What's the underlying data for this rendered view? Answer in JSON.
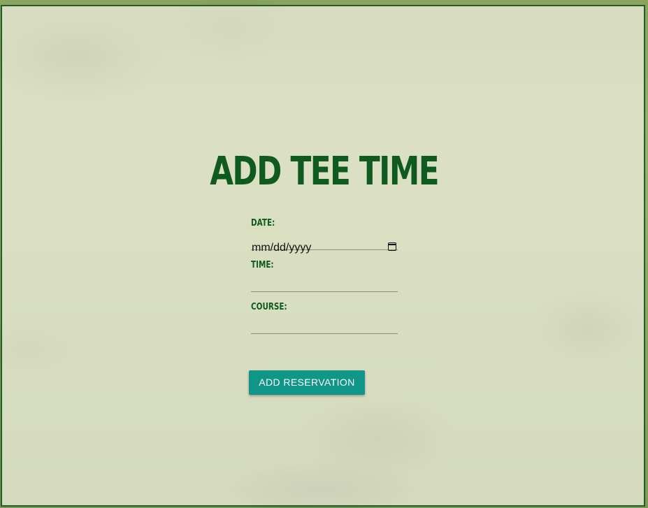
{
  "page": {
    "title": "ADD TEE TIME"
  },
  "form": {
    "date": {
      "label": "DATE:",
      "placeholder": "mm/dd/yyyy",
      "value": ""
    },
    "time": {
      "label": "TIME:",
      "value": ""
    },
    "course": {
      "label": "COURSE:",
      "value": ""
    },
    "submit_label": "ADD RESERVATION"
  },
  "icons": {
    "date_picker": "calendar-icon"
  },
  "colors": {
    "title": "#0f5a1e",
    "button": "#0f9688",
    "border": "#1f5e2a"
  }
}
